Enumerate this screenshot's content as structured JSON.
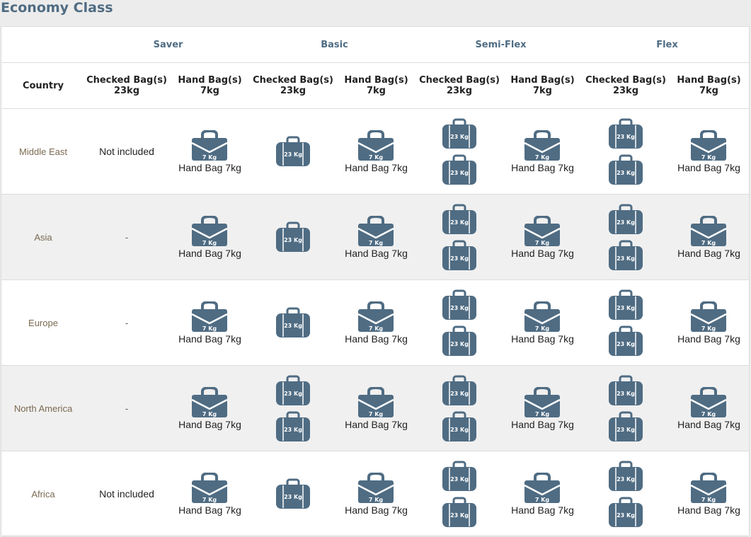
{
  "page": {
    "title": "Economy Class"
  },
  "tiers": [
    "Saver",
    "Basic",
    "Semi-Flex",
    "Flex"
  ],
  "columns": [
    "Country",
    "Checked Bag(s)\n23kg",
    "Hand Bag(s)\n7kg",
    "Checked Bag(s)\n23kg",
    "Hand Bag(s)\n7kg",
    "Checked Bag(s)\n23kg",
    "Hand Bag(s)\n7kg",
    "Checked Bag(s)\n23kg",
    "Hand Bag(s)\n7kg"
  ],
  "icons": {
    "checked": {
      "name": "suitcase-icon",
      "label": "23 Kg"
    },
    "hand": {
      "name": "briefcase-icon",
      "label": "7 Kg"
    }
  },
  "colors": {
    "icon": "#4f6c83",
    "tier_text": "#4f6c83",
    "country_text": "#7a6a52",
    "alt_row": "#f0f0f0"
  },
  "rows": [
    {
      "country": "Middle East",
      "cells": [
        {
          "text": "Not included"
        },
        {
          "hand": "Hand Bag 7kg"
        },
        {
          "bags": 1
        },
        {
          "hand": "Hand Bag 7kg"
        },
        {
          "bags": 2
        },
        {
          "hand": "Hand Bag 7kg"
        },
        {
          "bags": 2
        },
        {
          "hand": "Hand Bag 7kg"
        }
      ]
    },
    {
      "country": "Asia",
      "cells": [
        {
          "text": "-"
        },
        {
          "hand": "Hand Bag 7kg"
        },
        {
          "bags": 1
        },
        {
          "hand": "Hand Bag 7kg"
        },
        {
          "bags": 2
        },
        {
          "hand": "Hand Bag 7kg"
        },
        {
          "bags": 2
        },
        {
          "hand": "Hand Bag 7kg"
        }
      ]
    },
    {
      "country": "Europe",
      "cells": [
        {
          "text": "-"
        },
        {
          "hand": "Hand Bag 7kg"
        },
        {
          "bags": 1
        },
        {
          "hand": "Hand Bag 7kg"
        },
        {
          "bags": 2
        },
        {
          "hand": "Hand Bag 7kg"
        },
        {
          "bags": 2
        },
        {
          "hand": "Hand Bag 7kg"
        }
      ]
    },
    {
      "country": "North America",
      "cells": [
        {
          "text": "-"
        },
        {
          "hand": "Hand Bag 7kg"
        },
        {
          "bags": 2
        },
        {
          "hand": "Hand Bag 7kg"
        },
        {
          "bags": 2
        },
        {
          "hand": "Hand Bag 7kg"
        },
        {
          "bags": 2
        },
        {
          "hand": "Hand Bag 7kg"
        }
      ]
    },
    {
      "country": "Africa",
      "cells": [
        {
          "text": "Not included"
        },
        {
          "hand": "Hand Bag 7kg"
        },
        {
          "bags": 1
        },
        {
          "hand": "Hand Bag 7kg"
        },
        {
          "bags": 2
        },
        {
          "hand": "Hand Bag 7kg"
        },
        {
          "bags": 2
        },
        {
          "hand": "Hand Bag 7kg"
        }
      ]
    }
  ]
}
